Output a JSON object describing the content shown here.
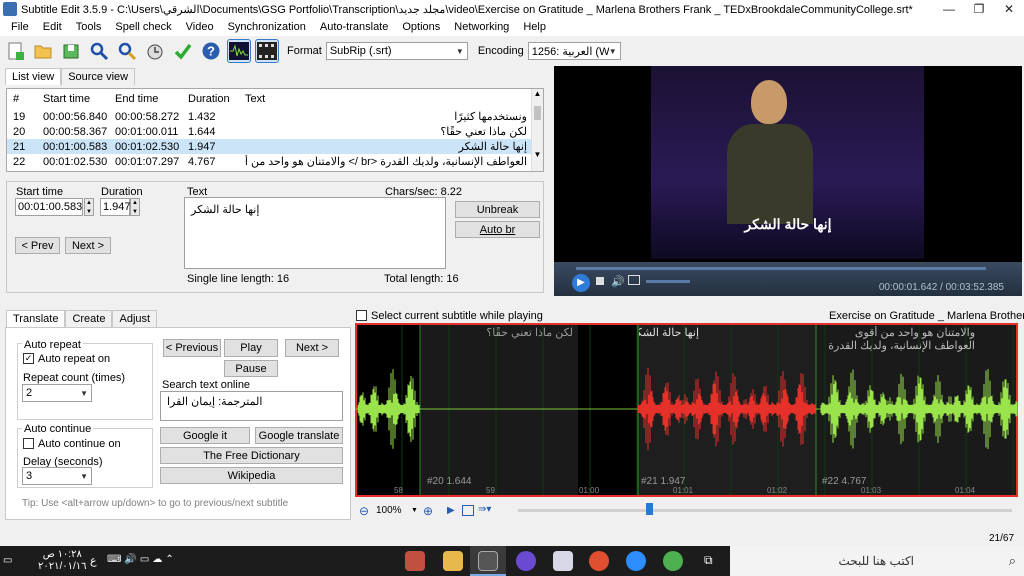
{
  "window": {
    "title": "Subtitle Edit 3.5.9 - C:\\Users\\الشرقي\\Documents\\GSG Portfolio\\Transcription\\مجلد جديد\\video\\Exercise on Gratitude _ Marlena Brothers Frank _ TEDxBrookdaleCommunityCollege.srt*",
    "minimize": "—",
    "maximize": "❐",
    "close": "✕"
  },
  "menu": [
    "File",
    "Edit",
    "Tools",
    "Spell check",
    "Video",
    "Synchronization",
    "Auto-translate",
    "Options",
    "Networking",
    "Help"
  ],
  "toolbar": {
    "format_label": "Format",
    "format_value": "SubRip (.srt)",
    "encoding_label": "Encoding",
    "encoding_value": "1256: العربية (Windo"
  },
  "view_tabs": {
    "list": "List view",
    "source": "Source view"
  },
  "grid": {
    "headers": [
      "#",
      "Start time",
      "End time",
      "Duration",
      "Text"
    ],
    "rows": [
      {
        "num": "19",
        "start": "00:00:56.840",
        "end": "00:00:58.272",
        "dur": "1.432",
        "text": "ونستخدمها كثيرًا"
      },
      {
        "num": "20",
        "start": "00:00:58.367",
        "end": "00:01:00.011",
        "dur": "1.644",
        "text": "لكن ماذا تعني حقًا؟"
      },
      {
        "num": "21",
        "start": "00:01:00.583",
        "end": "00:01:02.530",
        "dur": "1.947",
        "text": "إنها حالة الشكر"
      },
      {
        "num": "22",
        "start": "00:01:02.530",
        "end": "00:01:07.297",
        "dur": "4.767",
        "text": "العواطف الإنسانية، ولديك القدرة <br /> والامتنان هو واحد من أقوى"
      }
    ]
  },
  "editor": {
    "start_label": "Start time",
    "start_value": "00:01:00.583",
    "duration_label": "Duration",
    "duration_value": "1.947",
    "text_label": "Text",
    "chars_sec": "Chars/sec: 8.22",
    "text_value": "إنها حالة الشكر",
    "prev": "< Prev",
    "next": "Next >",
    "unbreak": "Unbreak",
    "auto_br": "Auto br",
    "single_line": "Single line length: 16",
    "total_length": "Total length: 16"
  },
  "video": {
    "subtitle": "إنها حالة الشكر",
    "time": "00:00:01.642 / 00:03:52.385"
  },
  "translate_tabs": [
    "Translate",
    "Create",
    "Adjust"
  ],
  "translate": {
    "auto_repeat": "Auto repeat",
    "auto_repeat_on": "Auto repeat on",
    "repeat_count": "Repeat count (times)",
    "repeat_value": "2",
    "auto_continue": "Auto continue",
    "auto_continue_on": "Auto continue on",
    "delay": "Delay (seconds)",
    "delay_value": "3",
    "prev": "< Previous",
    "play": "Play",
    "next": "Next >",
    "pause": "Pause",
    "search_online": "Search text online",
    "search_text": "المترجمة: إيمان القرا",
    "google_it": "Google it",
    "google_translate": "Google translate",
    "free_dict": "The Free Dictionary",
    "wikipedia": "Wikipedia",
    "tip": "Tip: Use <alt+arrow up/down> to go to previous/next subtitle"
  },
  "waveform": {
    "select_while_playing": "Select current subtitle while playing",
    "video_title": "Exercise on Gratitude _ Marlena Brothers Frank _",
    "seg_left_text": "لكن ماذا تعني حقًا؟",
    "seg_mid_text": "إنها حالة الشكر",
    "seg_right_text1": "والامتنان هو واحد من أقوى",
    "seg_right_text2": "العواطف الإنسانية، ولديك القدرة",
    "seg_left_label": "#20  1.644",
    "seg_mid_label": "#21  1.947",
    "seg_right_label": "#22  4.767",
    "ticks": [
      "58",
      "59",
      "01:00",
      "01:01",
      "01:02",
      "01:03",
      "01:04"
    ],
    "zoom": "100%",
    "counter": "21/67"
  },
  "taskbar": {
    "time": "١٠:٢٨ ص",
    "date": "٢٠٢١/٠١/١٦",
    "lang": "ع",
    "search": "اكتب هنا للبحث"
  },
  "colors": {
    "selected_row": "#cce4f7",
    "wave_green": "#9be34a",
    "wave_red": "#e6302a"
  }
}
